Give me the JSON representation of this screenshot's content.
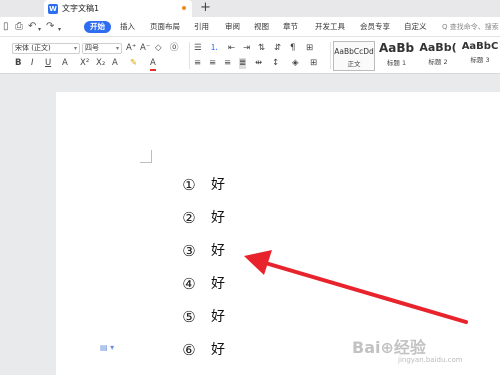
{
  "titlebar": {
    "doc_tab": {
      "title": "文字文稿1",
      "icon": "W"
    },
    "new_tab_label": "+"
  },
  "menubar": {
    "items": [
      {
        "label": "开始",
        "active": true
      },
      {
        "label": "插入"
      },
      {
        "label": "页面布局"
      },
      {
        "label": "引用"
      },
      {
        "label": "审阅"
      },
      {
        "label": "视图"
      },
      {
        "label": "章节"
      },
      {
        "label": "开发工具"
      },
      {
        "label": "会员专享"
      },
      {
        "label": "自定义"
      }
    ],
    "search_text": "Q 查找命令、搜索",
    "quick_icons": [
      "save-icon",
      "print-icon",
      "undo-icon",
      "redo-icon",
      "more-icon"
    ]
  },
  "ribbon": {
    "font_name": "宋体 (正文)",
    "font_size": "四号",
    "format_buttons": [
      "B",
      "I",
      "U",
      "A",
      "X²",
      "X₂",
      "A",
      "A"
    ],
    "font_glyphs": [
      "A⁺",
      "A⁻",
      "◇",
      "⓪"
    ],
    "styles": [
      {
        "sample": "AaBbCcDd",
        "name": "正文"
      },
      {
        "sample": "AaBb",
        "name": "标题 1"
      },
      {
        "sample": "AaBb(",
        "name": "标题 2"
      },
      {
        "sample": "AaBbC",
        "name": "标题 3"
      }
    ]
  },
  "document": {
    "list": [
      {
        "num": "1",
        "text": "好"
      },
      {
        "num": "2",
        "text": "好"
      },
      {
        "num": "3",
        "text": "好"
      },
      {
        "num": "4",
        "text": "好"
      },
      {
        "num": "5",
        "text": "好"
      },
      {
        "num": "6",
        "text": "好"
      }
    ]
  },
  "annotation": {
    "arrow_color": "#e8232b"
  },
  "watermark": {
    "main": "Bai⊕经验",
    "sub": "jingyan.baidu.com"
  },
  "colors": {
    "accent": "#2e6cf0",
    "page": "#ffffff",
    "canvas": "#e9eaec"
  }
}
